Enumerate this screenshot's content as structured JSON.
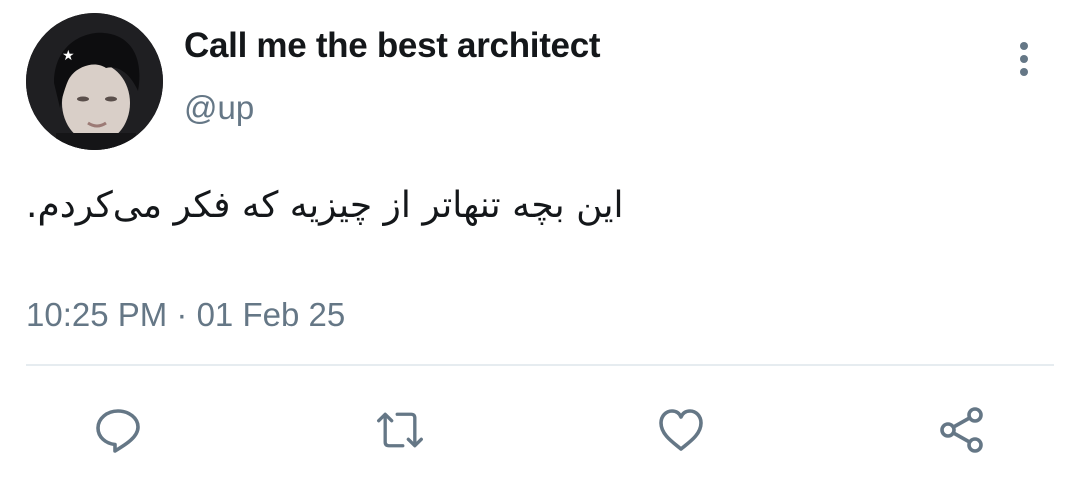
{
  "author": {
    "display_name": "Call me the best architect",
    "handle": "@up"
  },
  "tweet": {
    "text": "این بچه تنهاتر از چیزیه که فکر می‌کردم.",
    "timestamp": "10:25 PM · 01 Feb 25"
  },
  "actions": [
    {
      "icon": "reply-icon"
    },
    {
      "icon": "retweet-icon"
    },
    {
      "icon": "like-icon"
    },
    {
      "icon": "share-icon"
    }
  ],
  "colors": {
    "text_primary": "#14171a",
    "text_secondary": "#657786",
    "divider": "#e6ecf0"
  }
}
